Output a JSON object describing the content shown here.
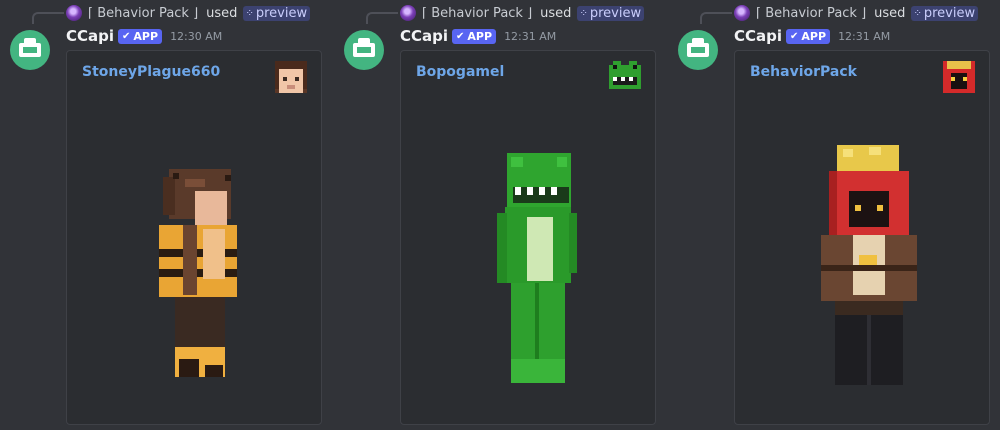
{
  "messages": [
    {
      "reply_command": "⌈ Behavior Pack ⌋",
      "reply_used": "used",
      "reply_tag_icon": "slash-command-icon",
      "reply_tag": "preview",
      "username": "CCapi",
      "badge": "APP",
      "timestamp": "12:30 AM",
      "embed_title": "StoneyPlague660"
    },
    {
      "reply_command": "⌈ Behavior Pack ⌋",
      "reply_used": "used",
      "reply_tag_icon": "slash-command-icon",
      "reply_tag": "preview",
      "username": "CCapi",
      "badge": "APP",
      "timestamp": "12:31 AM",
      "embed_title": "Bopogamel"
    },
    {
      "reply_command": "⌈ Behavior Pack ⌋",
      "reply_used": "used",
      "reply_tag_icon": "slash-command-icon",
      "reply_tag": "preview",
      "username": "CCapi",
      "badge": "APP",
      "timestamp": "12:31 AM",
      "embed_title": "BehaviorPack"
    }
  ],
  "colors": {
    "background": "#313338",
    "embed": "#2b2d31",
    "link": "#6ea6e8",
    "badge": "#5865f2",
    "bot_avatar": "#43b581"
  }
}
